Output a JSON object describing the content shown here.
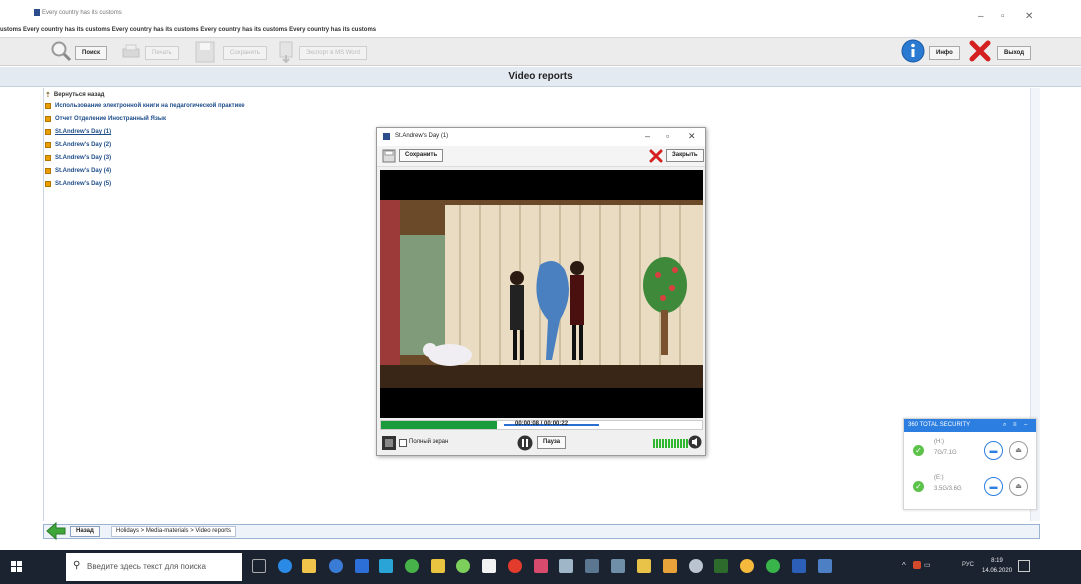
{
  "window": {
    "title": "Every country has its customs",
    "marquee": "ustoms  Every country has its customs  Every country has its customs  Every country has its customs  Every country has its customs"
  },
  "toolbar": {
    "search_label": "Поиск",
    "print_label": "Печать",
    "save_label": "Сохранить",
    "export_label": "Экспорт в MS Word",
    "info_label": "Инфо",
    "exit_label": "Выход"
  },
  "section": {
    "title": "Video reports"
  },
  "list": {
    "back_label": "Вернуться назад",
    "items": [
      "Использование электронной книги на педагогической практике",
      "Отчет Отделение Иностранный Язык",
      "St.Andrew's Day (1)",
      "St.Andrew's Day (2)",
      "St.Andrew's Day (3)",
      "St.Andrew's Day (4)",
      "St.Andrew's Day (5)"
    ]
  },
  "video_window": {
    "title": "St.Andrew's Day (1)",
    "save_label": "Сохранить",
    "close_label": "Закрыть",
    "time": "00:00:08 / 00:00:22",
    "progress": 0.36,
    "fullscreen_label": "Полный экран",
    "pause_label": "Пауза"
  },
  "security_widget": {
    "title": "360 TOTAL SECURITY",
    "drives": [
      {
        "name": "(H:)",
        "size": "7G/7.1G"
      },
      {
        "name": "(E:)",
        "size": "3.5G/3.6G"
      }
    ]
  },
  "bottom_nav": {
    "back_label": "Назад",
    "breadcrumb": "Holidays > Media-materials > Video reports"
  },
  "taskbar": {
    "search_placeholder": "Введите здесь текст для поиска",
    "tray": "РУС",
    "time": "8:19",
    "date": "14.06.2020"
  },
  "colors": {
    "accent": "#1e4d8a",
    "progress": "#1a9b3c",
    "security_blue": "#2c7fe0",
    "taskbar": "#1b2331"
  }
}
